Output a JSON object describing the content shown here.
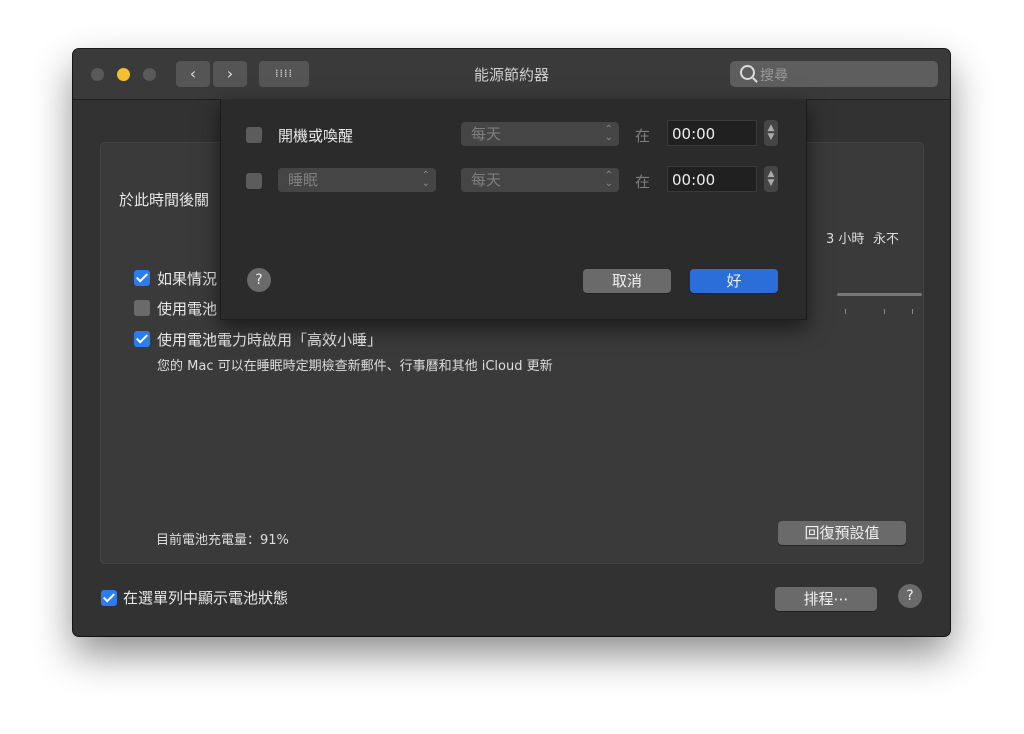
{
  "window": {
    "title": "能源節約器",
    "search_placeholder": "搜尋"
  },
  "panel": {
    "turn_off_label": "於此時間後關",
    "slider_right_labels": [
      "3 小時",
      "永不"
    ],
    "options": [
      {
        "label": "如果情況",
        "checked": true
      },
      {
        "label": "使用電池",
        "checked": false
      },
      {
        "label": "使用電池電力時啟用「高效小睡」",
        "checked": true
      }
    ],
    "power_nap_description": "您的 Mac 可以在睡眠時定期檢查新郵件、行事曆和其他 iCloud 更新",
    "battery_status": "目前電池充電量：91%",
    "restore_defaults": "回復預設值"
  },
  "footer": {
    "show_in_menubar_label": "在選單列中顯示電池狀態",
    "show_in_menubar_checked": true,
    "schedule_button": "排程⋯",
    "help": "?"
  },
  "schedule_sheet": {
    "rows": [
      {
        "checked": false,
        "action": "開機或喚醒",
        "action_is_popup": false,
        "frequency": "每天",
        "at": "在",
        "time": "00:00"
      },
      {
        "checked": false,
        "action": "睡眠",
        "action_is_popup": true,
        "frequency": "每天",
        "at": "在",
        "time": "00:00"
      }
    ],
    "help": "?",
    "cancel": "取消",
    "ok": "好"
  }
}
